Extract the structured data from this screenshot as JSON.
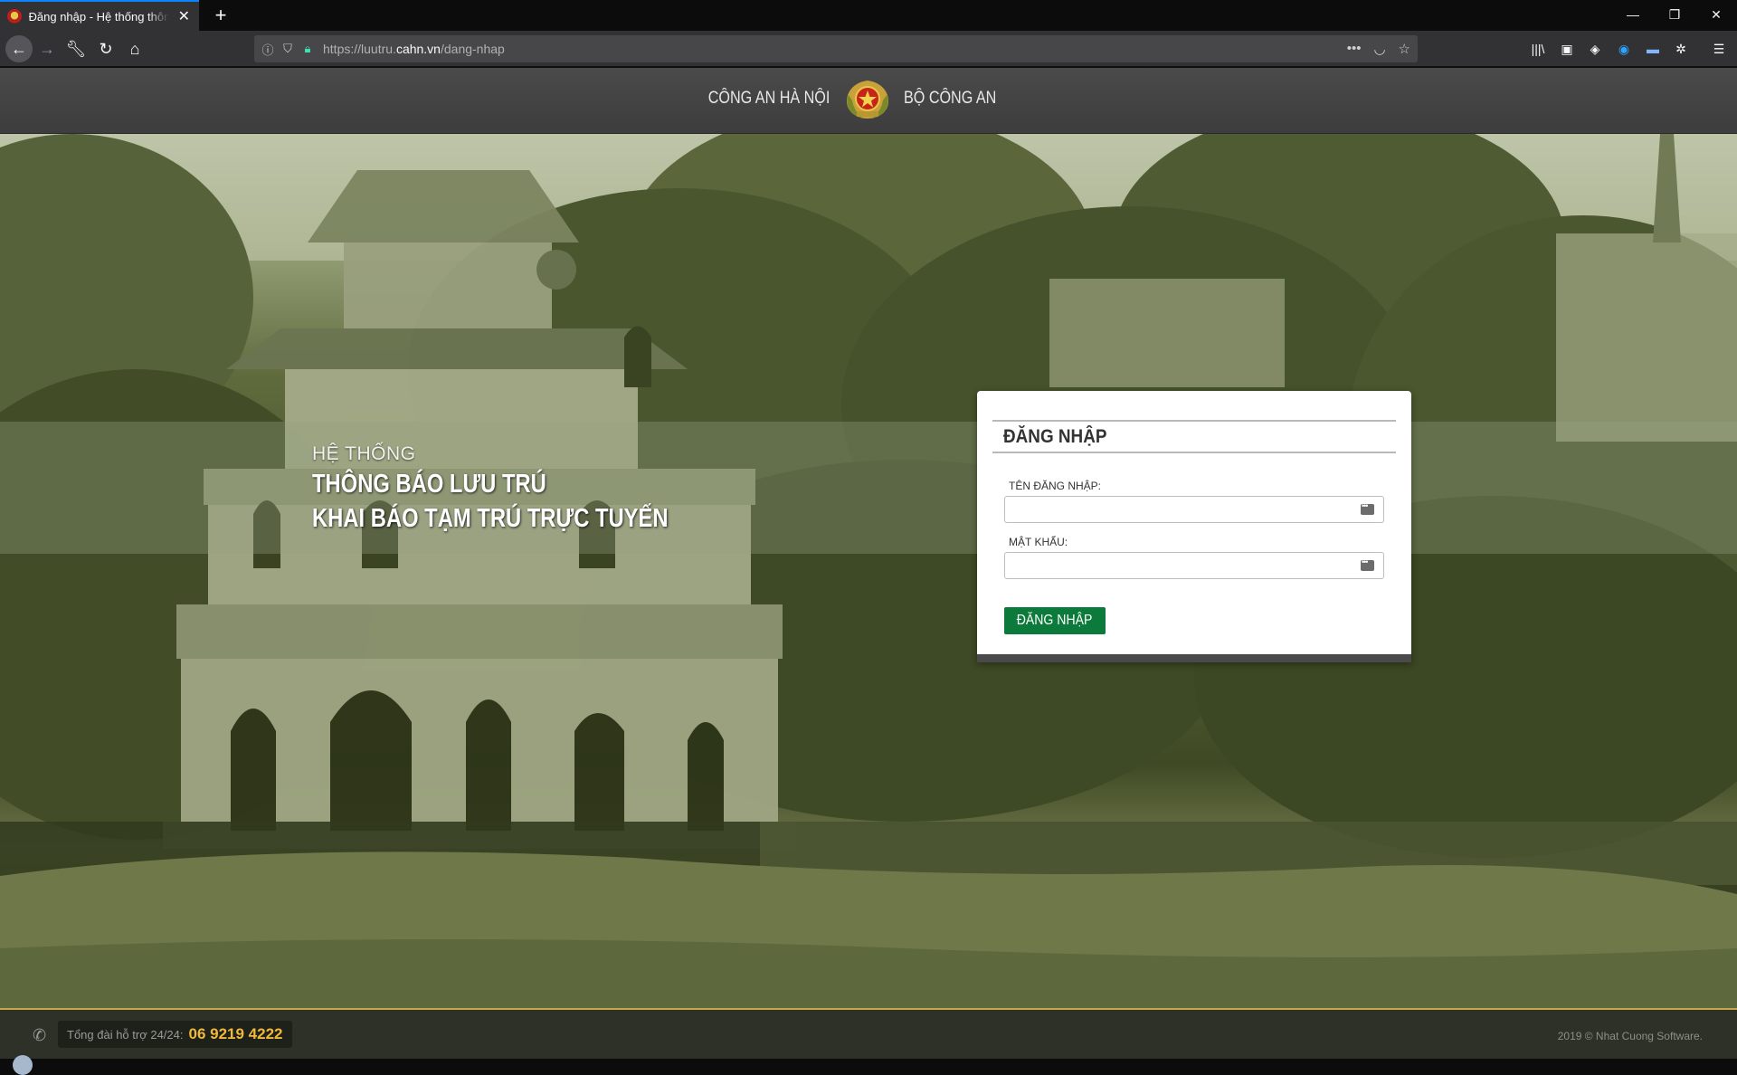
{
  "browser": {
    "tab_title": "Đăng nhập - Hệ thống thông báo lưu trú",
    "tab_close": "✕",
    "new_tab": "+",
    "url_prefix": "https://luutru.",
    "url_domain": "cahn.vn",
    "url_path": "/dang-nhap",
    "window_controls": [
      "—",
      "❐",
      "✕"
    ],
    "nav_icons": [
      "back-icon",
      "forward-icon",
      "wrench-icon",
      "reload-icon",
      "home-icon"
    ],
    "toolbar_icons": [
      "library-icon",
      "sidebar-icon",
      "extension-icon",
      "extension-icon",
      "extension-icon",
      "extension-icon",
      "menu-icon"
    ]
  },
  "header": {
    "left_text": "CÔNG AN HÀ NỘI",
    "right_text": "BỘ CÔNG AN"
  },
  "hero": {
    "subtitle": "HỆ THỐNG",
    "line1": "THÔNG BÁO LƯU TRÚ",
    "line2": "KHAI BÁO TẠM TRÚ TRỰC TUYẾN"
  },
  "login": {
    "title": "ĐĂNG NHẬP",
    "username_label": "TÊN ĐĂNG NHẬP:",
    "username_value": "",
    "password_label": "MẬT KHẨU:",
    "password_value": "",
    "submit_label": "ĐĂNG NHẬP"
  },
  "footer": {
    "support_label": "Tổng đài hỗ trợ 24/24:",
    "support_number": "06 9219 4222",
    "copyright": "2019 © Nhat Cuong Software."
  },
  "colors": {
    "accent_button": "#0b7a3b",
    "footer_accent": "#c9a84a",
    "phone_number": "#f0b93a"
  }
}
